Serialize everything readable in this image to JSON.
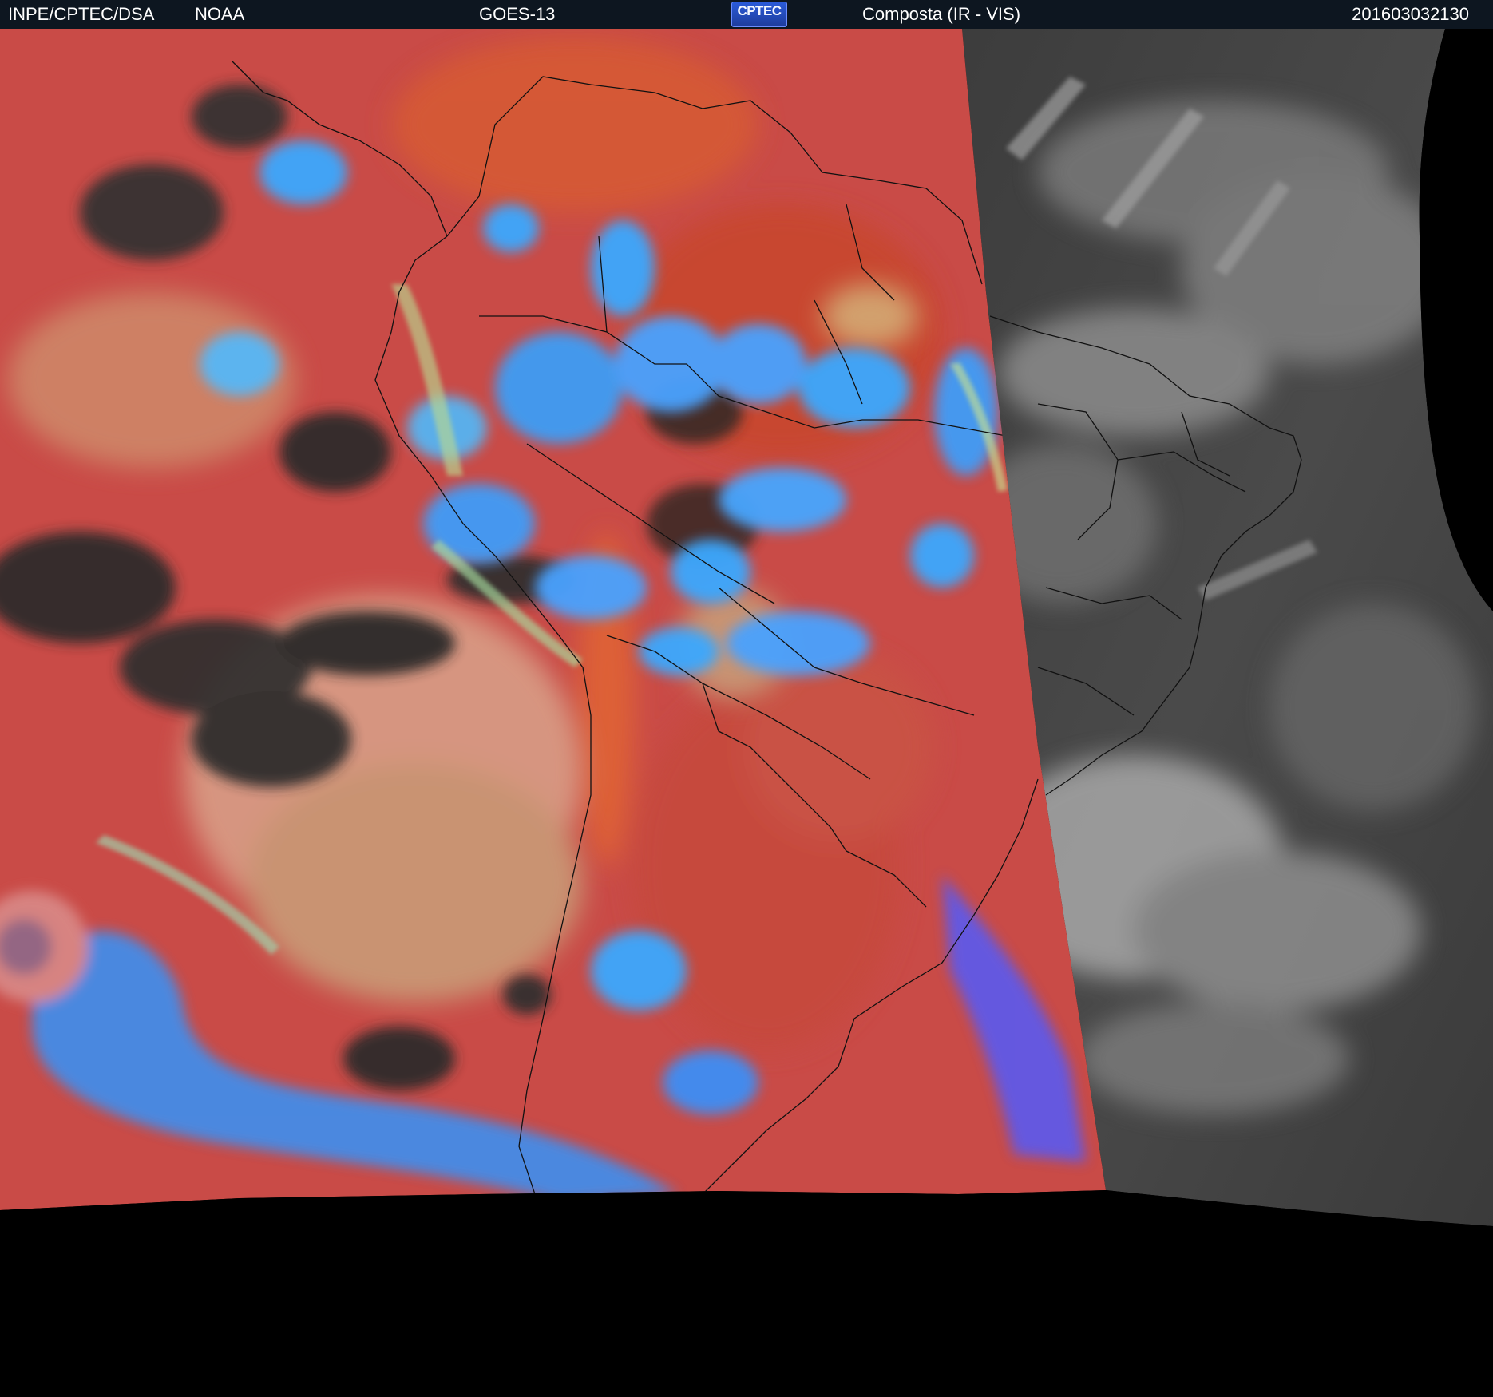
{
  "header": {
    "organization": "INPE/CPTEC/DSA",
    "agency": "NOAA",
    "satellite": "GOES-13",
    "logo_text": "CPTEC",
    "product": "Composta (IR - VIS)",
    "timestamp": "201603032130"
  },
  "colors": {
    "header_background": "#0d1620",
    "header_text": "#ffffff",
    "ir_red": "#c94b47",
    "ir_orange": "#d85a35",
    "cold_cloud_blue": "#3fa6ff",
    "clear_gray": "#2a2a2a",
    "visible_gray": "#505050",
    "coastline": "#111111",
    "background": "#000000"
  },
  "icons": {
    "logo": "cptec-logo"
  }
}
